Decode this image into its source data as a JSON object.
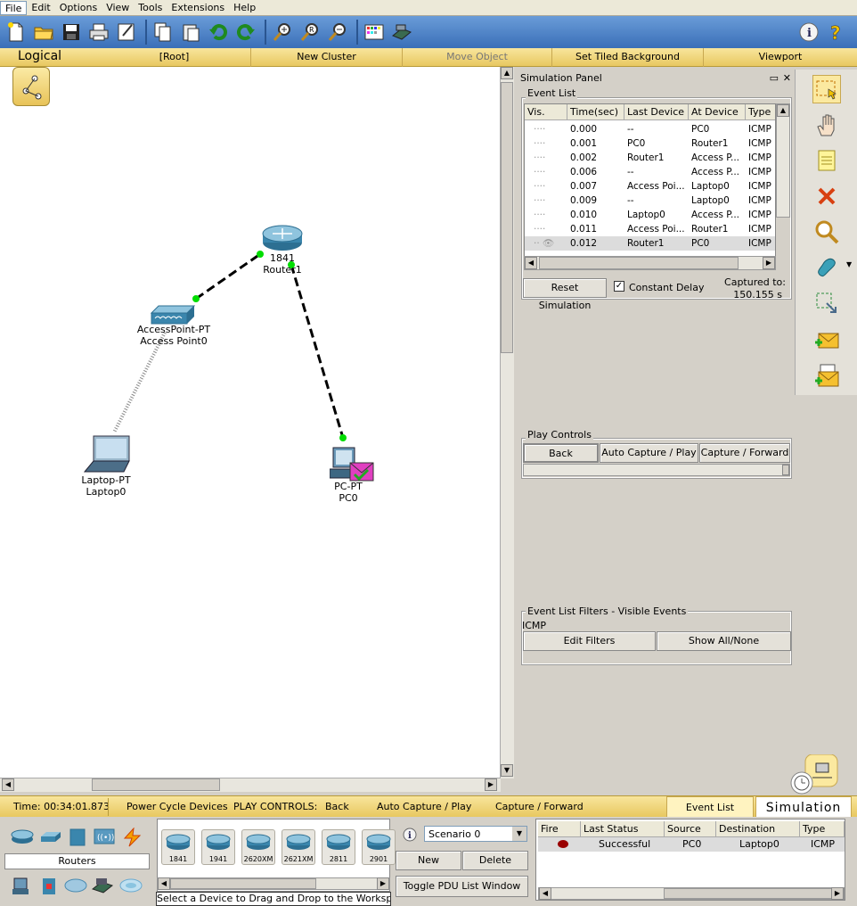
{
  "menu": [
    "File",
    "Edit",
    "Options",
    "View",
    "Tools",
    "Extensions",
    "Help"
  ],
  "nav": {
    "logical": "Logical",
    "root": "[Root]",
    "new_cluster": "New Cluster",
    "move_object": "Move Object",
    "tiled_bg": "Set Tiled Background",
    "viewport": "Viewport"
  },
  "devices": {
    "router": {
      "model": "1841",
      "name": "Router1"
    },
    "ap": {
      "model": "AccessPoint-PT",
      "name": "Access Point0"
    },
    "laptop": {
      "model": "Laptop-PT",
      "name": "Laptop0"
    },
    "pc": {
      "model": "PC-PT",
      "name": "PC0"
    }
  },
  "sim": {
    "title": "Simulation Panel",
    "event_list_title": "Event List",
    "columns": [
      "Vis.",
      "Time(sec)",
      "Last Device",
      "At Device",
      "Type"
    ],
    "events": [
      {
        "time": "0.000",
        "last": "--",
        "at": "PC0",
        "type": "ICMP"
      },
      {
        "time": "0.001",
        "last": "PC0",
        "at": "Router1",
        "type": "ICMP"
      },
      {
        "time": "0.002",
        "last": "Router1",
        "at": "Access P...",
        "type": "ICMP"
      },
      {
        "time": "0.006",
        "last": "--",
        "at": "Access P...",
        "type": "ICMP"
      },
      {
        "time": "0.007",
        "last": "Access Poi...",
        "at": "Laptop0",
        "type": "ICMP"
      },
      {
        "time": "0.009",
        "last": "--",
        "at": "Laptop0",
        "type": "ICMP"
      },
      {
        "time": "0.010",
        "last": "Laptop0",
        "at": "Access P...",
        "type": "ICMP"
      },
      {
        "time": "0.011",
        "last": "Access Poi...",
        "at": "Router1",
        "type": "ICMP"
      },
      {
        "time": "0.012",
        "last": "Router1",
        "at": "PC0",
        "type": "ICMP"
      }
    ],
    "reset": "Reset Simulation",
    "constant_delay": "Constant Delay",
    "captured_to_label": "Captured to:",
    "captured_to_value": "150.155 s",
    "play_controls_title": "Play Controls",
    "back": "Back",
    "auto_capture": "Auto Capture / Play",
    "capture_forward": "Capture / Forward",
    "filters_title": "Event List Filters - Visible Events",
    "filter_value": "ICMP",
    "edit_filters": "Edit Filters",
    "show_all": "Show All/None"
  },
  "bottom": {
    "time": "Time: 00:34:01.873",
    "power_cycle": "Power Cycle Devices",
    "play_controls": "PLAY CONTROLS:",
    "back": "Back",
    "auto_capture": "Auto Capture / Play",
    "capture_forward": "Capture / Forward",
    "event_list": "Event List",
    "simulation": "Simulation"
  },
  "chooser": {
    "category": "Routers",
    "models": [
      "1841",
      "1941",
      "2620XM",
      "2621XM",
      "2811",
      "2901"
    ],
    "hint": "Select a Device to Drag and Drop to the Workspace",
    "scenario": "Scenario 0",
    "new": "New",
    "delete": "Delete",
    "toggle_pdu": "Toggle PDU List Window"
  },
  "pdu": {
    "columns": [
      "Fire",
      "Last Status",
      "Source",
      "Destination",
      "Type"
    ],
    "rows": [
      {
        "status": "Successful",
        "source": "PC0",
        "destination": "Laptop0",
        "type": "ICMP"
      }
    ]
  }
}
